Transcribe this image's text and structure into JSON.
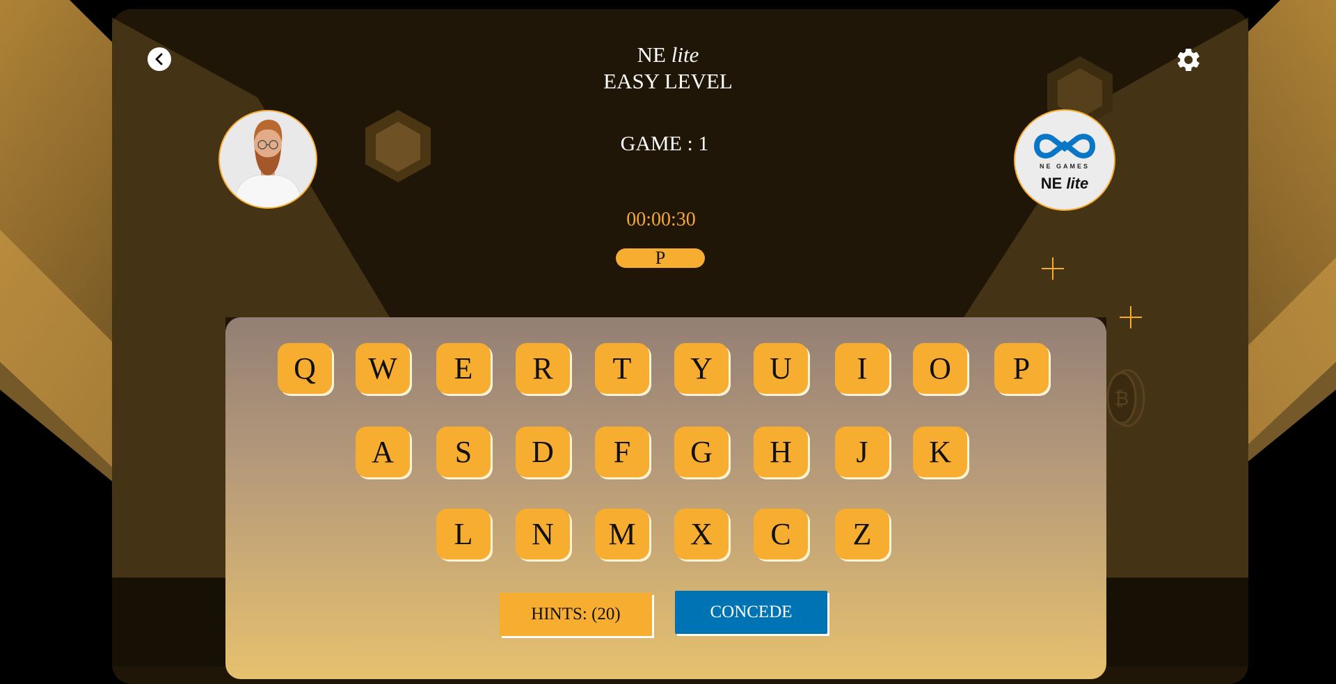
{
  "header": {
    "brand": "NE",
    "brand_suffix": "lite",
    "level": "EASY LEVEL",
    "game_label": "GAME : 1",
    "timer": "00:00:30",
    "current_letter": "P"
  },
  "player": {
    "avatar": "player-avatar"
  },
  "opponent": {
    "logo_top": "NE GAMES",
    "logo_name": "NE",
    "logo_suffix": "lite"
  },
  "keyboard": {
    "row1": [
      "Q",
      "W",
      "E",
      "R",
      "T",
      "Y",
      "U",
      "I",
      "O",
      "P"
    ],
    "row2": [
      "A",
      "S",
      "D",
      "F",
      "G",
      "H",
      "J",
      "K"
    ],
    "row3": [
      "L",
      "N",
      "M",
      "X",
      "C",
      "Z"
    ]
  },
  "actions": {
    "hints_label": "HINTS: (20)",
    "concede_label": "CONCEDE"
  },
  "colors": {
    "accent": "#f7ad2f",
    "panel": "#1f1607",
    "concede": "#0073b5",
    "keyboard_top": "#937f74",
    "keyboard_bottom": "#e6c16e"
  },
  "icons": {
    "back": "chevron-left-icon",
    "settings": "gear-icon",
    "decor_hex": "hexagon-icon",
    "decor_sparkle": "sparkle-icon",
    "decor_coin": "bitcoin-coin-icon"
  }
}
